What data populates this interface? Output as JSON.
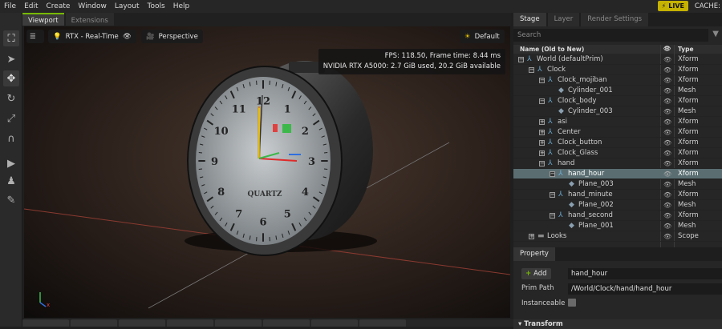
{
  "menu": [
    "File",
    "Edit",
    "Create",
    "Window",
    "Layout",
    "Tools",
    "Help"
  ],
  "live_label": "LIVE",
  "cache_label": "CACHE:",
  "viewport_tabs": [
    "Viewport",
    "Extensions"
  ],
  "viewport": {
    "render_mode": "RTX - Real-Time",
    "camera": "Perspective",
    "lighting": "Default",
    "fps_line": "FPS: 118.50, Frame time: 8.44 ms",
    "gpu_line": "NVIDIA RTX A5000: 2.7 GiB used, 20.2 GiB available",
    "clock_brand": "QUARTZ",
    "clock_numbers": [
      "12",
      "1",
      "2",
      "3",
      "4",
      "5",
      "6",
      "7",
      "8",
      "9",
      "10",
      "11"
    ]
  },
  "right_tabs": [
    "Stage",
    "Layer",
    "Render Settings"
  ],
  "search_placeholder": "Search",
  "stage_header": {
    "name": "Name (Old to New)",
    "type": "Type"
  },
  "stage_tree": [
    {
      "name": "World (defaultPrim)",
      "type": "Xform",
      "depth": 0,
      "icon": "xform",
      "exp": "-"
    },
    {
      "name": "Clock",
      "type": "Xform",
      "depth": 1,
      "icon": "xform",
      "exp": "-"
    },
    {
      "name": "Clock_mojiban",
      "type": "Xform",
      "depth": 2,
      "icon": "xform",
      "exp": "-"
    },
    {
      "name": "Cylinder_001",
      "type": "Mesh",
      "depth": 3,
      "icon": "mesh",
      "exp": ""
    },
    {
      "name": "Clock_body",
      "type": "Xform",
      "depth": 2,
      "icon": "xform",
      "exp": "-"
    },
    {
      "name": "Cylinder_003",
      "type": "Mesh",
      "depth": 3,
      "icon": "mesh",
      "exp": ""
    },
    {
      "name": "asi",
      "type": "Xform",
      "depth": 2,
      "icon": "xform",
      "exp": "+"
    },
    {
      "name": "Center",
      "type": "Xform",
      "depth": 2,
      "icon": "xform",
      "exp": "+"
    },
    {
      "name": "Clock_button",
      "type": "Xform",
      "depth": 2,
      "icon": "xform",
      "exp": "+"
    },
    {
      "name": "Clock_Glass",
      "type": "Xform",
      "depth": 2,
      "icon": "xform",
      "exp": "+"
    },
    {
      "name": "hand",
      "type": "Xform",
      "depth": 2,
      "icon": "xform",
      "exp": "-"
    },
    {
      "name": "hand_hour",
      "type": "Xform",
      "depth": 3,
      "icon": "xform",
      "exp": "-",
      "selected": true
    },
    {
      "name": "Plane_003",
      "type": "Mesh",
      "depth": 4,
      "icon": "mesh",
      "exp": ""
    },
    {
      "name": "hand_minute",
      "type": "Xform",
      "depth": 3,
      "icon": "xform",
      "exp": "-"
    },
    {
      "name": "Plane_002",
      "type": "Mesh",
      "depth": 4,
      "icon": "mesh",
      "exp": ""
    },
    {
      "name": "hand_second",
      "type": "Xform",
      "depth": 3,
      "icon": "xform",
      "exp": "-"
    },
    {
      "name": "Plane_001",
      "type": "Mesh",
      "depth": 4,
      "icon": "mesh",
      "exp": ""
    },
    {
      "name": "Looks",
      "type": "Scope",
      "depth": 1,
      "icon": "folder",
      "exp": "+"
    }
  ],
  "property": {
    "tab": "Property",
    "add_label": "Add",
    "name_value": "hand_hour",
    "prim_path_label": "Prim Path",
    "prim_path_value": "/World/Clock/hand/hand_hour",
    "instanceable_label": "Instanceable",
    "transform_label": "Transform"
  },
  "colors": {
    "accent": "#76b900",
    "live": "#c6b200",
    "selected_row": "#5a6e72"
  }
}
